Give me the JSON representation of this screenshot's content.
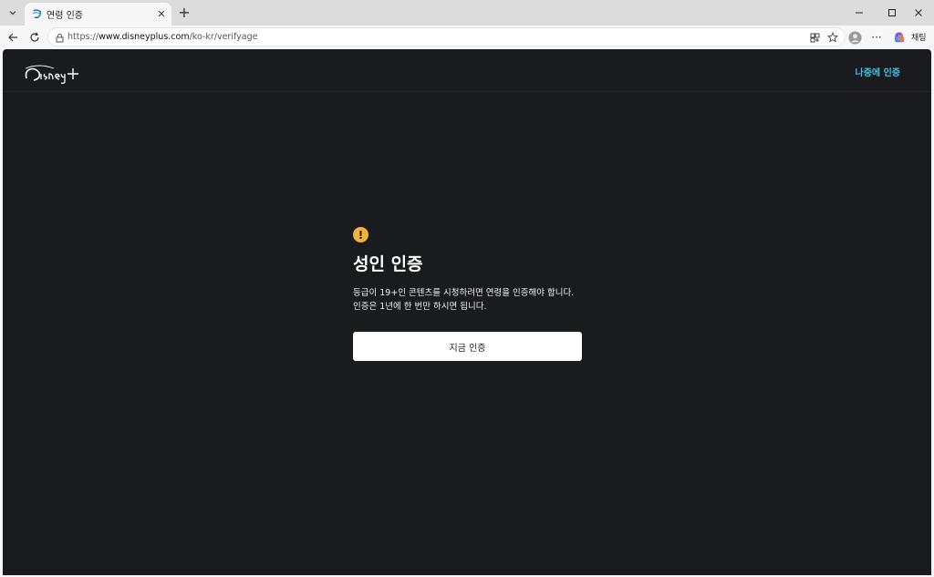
{
  "browser": {
    "tab_title": "연령 인증",
    "url_scheme": "https://",
    "url_host": "www.disneyplus.com",
    "url_path": "/ko-kr/verifyage",
    "chat_label": "채팅"
  },
  "page": {
    "logo_text": "Disney+",
    "later_link": "나중에 인증",
    "title": "성인 인증",
    "description": "등급이 19+인 콘텐츠를 시청하려면 연령을 인증해야 합니다. 인증은 1년에 한 번만 하시면 됩니다.",
    "verify_button": "지금 인증",
    "accent_color": "#3ec3e6",
    "warning_color": "#f3b23a"
  }
}
